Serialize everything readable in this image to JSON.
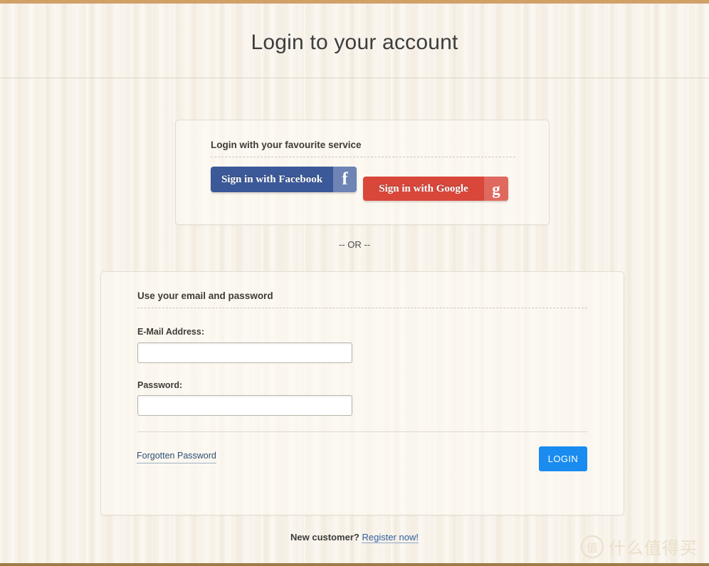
{
  "header": {
    "title": "Login to your account"
  },
  "social": {
    "heading": "Login with your favourite service",
    "facebook": {
      "label": "Sign in with Facebook",
      "icon": "facebook-f-icon",
      "glyph": "f",
      "color": "#3b5998",
      "icon_color": "#6d84b4"
    },
    "google": {
      "label": "Sign in with Google",
      "icon": "google-g-icon",
      "glyph": "g",
      "color": "#d9473b",
      "icon_color": "#e0695f"
    }
  },
  "separator": {
    "text": "-- OR --"
  },
  "credentials": {
    "heading": "Use your email and password",
    "email": {
      "label": "E-Mail Address:",
      "value": "",
      "placeholder": ""
    },
    "password": {
      "label": "Password:",
      "value": "",
      "placeholder": ""
    },
    "forgotten_password_label": "Forgotten Password",
    "login_button_label": "LOGIN",
    "login_button_color": "#1a8cf0"
  },
  "footer": {
    "new_customer_text": "New customer?",
    "register_link_label": "Register now!"
  },
  "watermark": {
    "badge": "值",
    "text": "什么值得买"
  },
  "theme": {
    "top_bar_color": "#cfa167",
    "bottom_bar_color": "#9d7b48",
    "background_color": "#f7f1e7"
  }
}
